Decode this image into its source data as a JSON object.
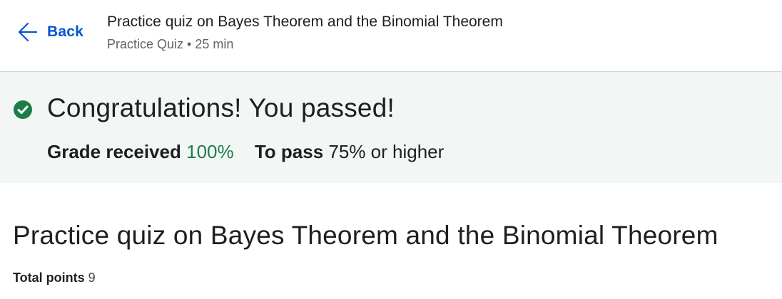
{
  "header": {
    "back_label": "Back",
    "title": "Practice quiz on Bayes Theorem and the Binomial Theorem",
    "meta": "Practice Quiz • 25 min"
  },
  "banner": {
    "icon": "check-circle-icon",
    "title": "Congratulations! You passed!",
    "grade_label": "Grade received",
    "grade_value": "100%",
    "pass_label": "To pass",
    "pass_value": "75% or higher"
  },
  "main": {
    "title": "Practice quiz on Bayes Theorem and the Binomial Theorem",
    "total_points_label": "Total points",
    "total_points_value": "9"
  },
  "colors": {
    "link": "#0056d2",
    "success": "#1e7c4b",
    "banner_bg": "#f2f7f5"
  }
}
